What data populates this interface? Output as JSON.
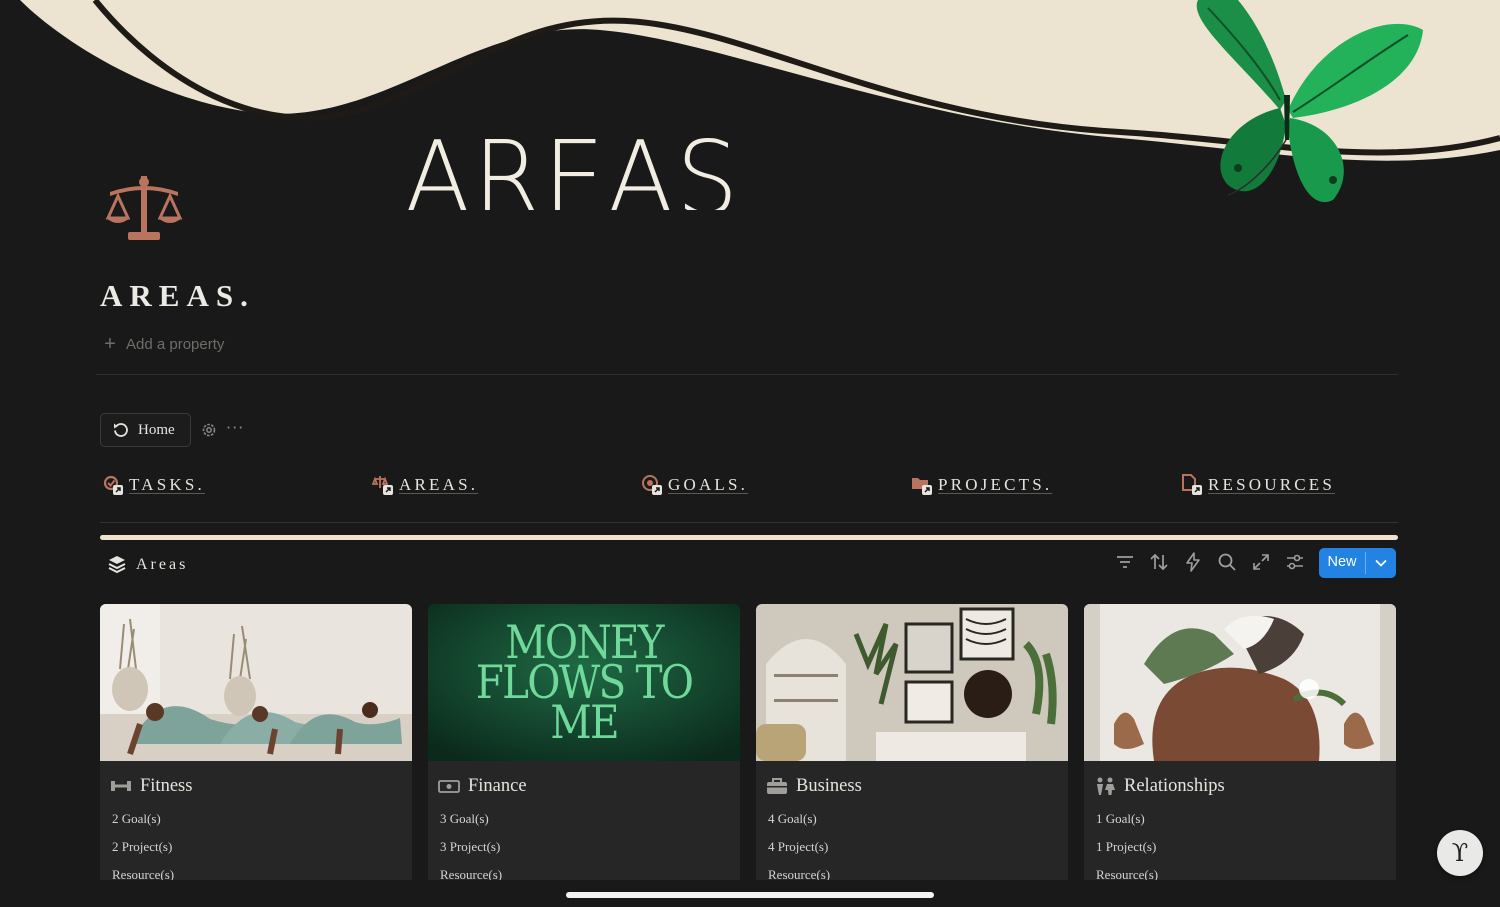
{
  "cover": {
    "word": "AREAS",
    "accent_color": "#ede3d1",
    "butterfly": "butterfly-illustration"
  },
  "page": {
    "icon": "scales-icon",
    "title": "AREAS.",
    "add_property": "Add a property"
  },
  "toolbar": {
    "home_label": "Home",
    "gear": "gear-icon",
    "more": "···"
  },
  "nav": [
    {
      "label": "TASKS.",
      "icon": "tasks-link-icon"
    },
    {
      "label": "AREAS.",
      "icon": "areas-link-icon"
    },
    {
      "label": "GOALS.",
      "icon": "goals-link-icon"
    },
    {
      "label": "PROJECTS.",
      "icon": "projects-link-icon"
    },
    {
      "label": "RESOURCES",
      "icon": "resources-link-icon"
    }
  ],
  "database": {
    "title": "Areas",
    "icon": "layers-icon",
    "tools": [
      "filter-icon",
      "sort-icon",
      "automation-icon",
      "search-icon",
      "expand-icon",
      "settings-sliders-icon"
    ],
    "new_label": "New"
  },
  "cards": [
    {
      "name": "Fitness",
      "icon": "dumbbell-icon",
      "goals": "2 Goal(s)",
      "projects": "2 Project(s)",
      "resources": "Resource(s)"
    },
    {
      "name": "Finance",
      "icon": "money-icon",
      "cover_text": "MONEY FLOWS TO ME",
      "goals": "3 Goal(s)",
      "projects": "3 Project(s)",
      "resources": "Resource(s)"
    },
    {
      "name": "Business",
      "icon": "briefcase-icon",
      "goals": "4 Goal(s)",
      "projects": "4 Project(s)",
      "resources": "Resource(s)"
    },
    {
      "name": "Relationships",
      "icon": "people-icon",
      "goals": "1 Goal(s)",
      "projects": "1 Project(s)",
      "resources": "Resource(s)"
    }
  ],
  "colors": {
    "background": "#191919",
    "card": "#262626",
    "accent_blue": "#2383e2",
    "copper": "#b9745f",
    "cream": "#efe3d0"
  }
}
